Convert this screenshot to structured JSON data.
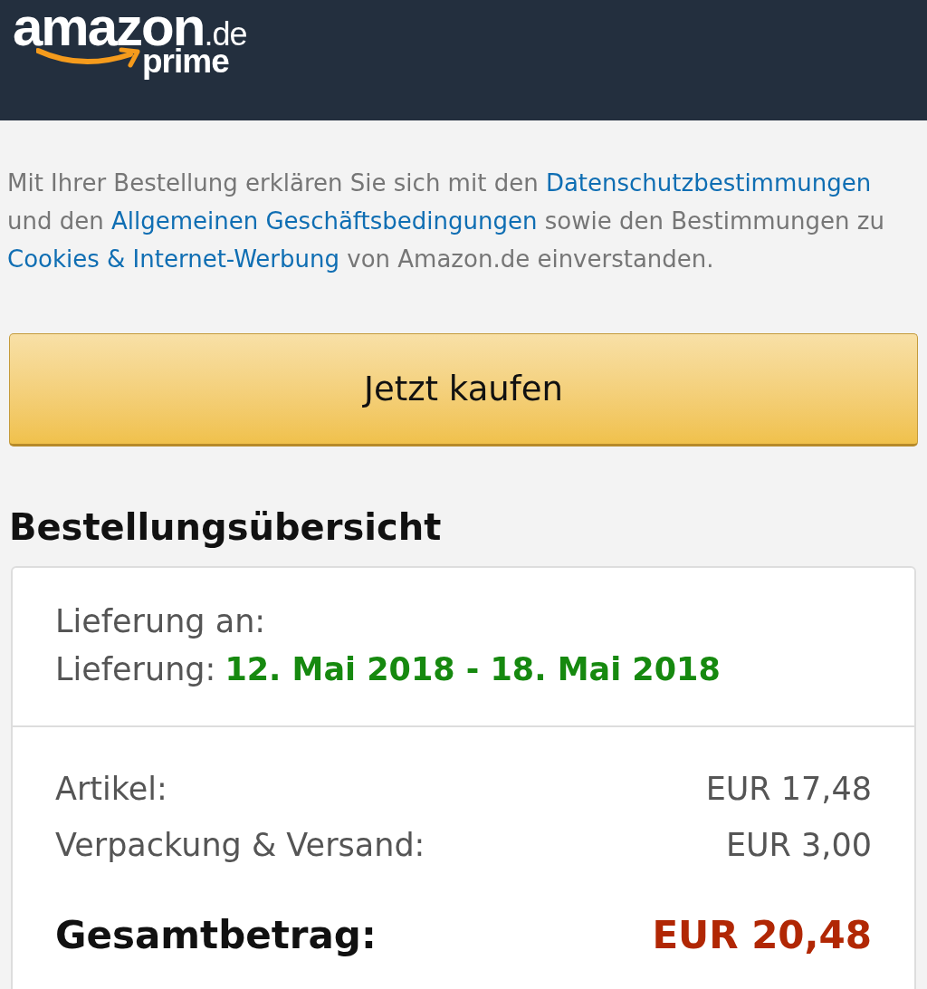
{
  "header": {
    "logo": {
      "wordmark": "amazon",
      "domain": ".de",
      "program": "prime"
    }
  },
  "consent": {
    "parts": [
      {
        "kind": "text",
        "text": "Mit Ihrer Bestellung erklären Sie sich mit den "
      },
      {
        "kind": "link",
        "text": "Datenschutzbestimmungen"
      },
      {
        "kind": "text",
        "text": " und den "
      },
      {
        "kind": "link",
        "text": "Allgemeinen Geschäftsbedingungen"
      },
      {
        "kind": "text",
        "text": " sowie den Bestimmungen zu "
      },
      {
        "kind": "link",
        "text": "Cookies & Internet-Werbung"
      },
      {
        "kind": "text",
        "text": " von Amazon.de einverstanden."
      }
    ]
  },
  "buy_button": {
    "label": "Jetzt kaufen"
  },
  "summary": {
    "title": "Bestellungsübersicht",
    "delivery": [
      {
        "label": "Lieferung an:"
      },
      {
        "label": "Lieferung:",
        "value": "12. Mai 2018 - 18. Mai 2018"
      }
    ],
    "costs": [
      {
        "label": "Artikel:",
        "amount": "EUR 17,48"
      },
      {
        "label": "Verpackung & Versand:",
        "amount": "EUR 3,00"
      }
    ],
    "total": {
      "label": "Gesamtbetrag:",
      "amount": "EUR 20,48"
    }
  }
}
